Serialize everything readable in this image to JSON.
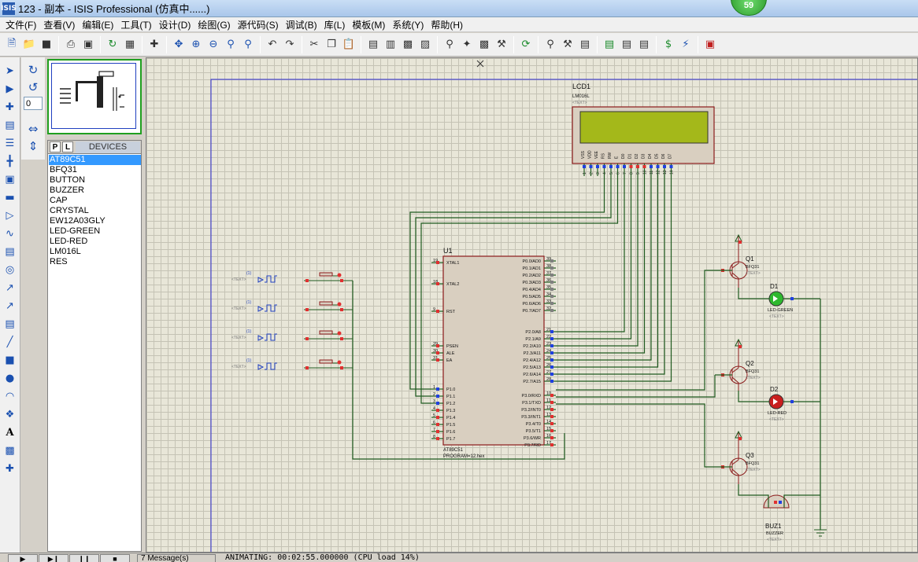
{
  "window": {
    "icon": "ISIS",
    "title": "123 - 副本 - ISIS Professional (仿真中......)",
    "badge": "59"
  },
  "menu": [
    "文件(F)",
    "查看(V)",
    "编辑(E)",
    "工具(T)",
    "设计(D)",
    "绘图(G)",
    "源代码(S)",
    "调试(B)",
    "库(L)",
    "模板(M)",
    "系统(Y)",
    "帮助(H)"
  ],
  "rotation": {
    "angle_value": "0"
  },
  "devices": {
    "tab_p": "P",
    "tab_l": "L",
    "header": "DEVICES",
    "items": [
      "AT89C51",
      "BFQ31",
      "BUTTON",
      "BUZZER",
      "CAP",
      "CRYSTAL",
      "EW12A03GLY",
      "LED-GREEN",
      "LED-RED",
      "LM016L",
      "RES"
    ],
    "selected": "AT89C51"
  },
  "schematic": {
    "lcd": {
      "ref": "LCD1",
      "part": "LM016L",
      "text": "<TEXT>",
      "pins": [
        "VSS",
        "VDD",
        "VEE",
        "RS",
        "RW",
        "E",
        "D0",
        "D1",
        "D2",
        "D3",
        "D4",
        "D5",
        "D6",
        "D7"
      ],
      "pin_numbers": [
        "1",
        "2",
        "3",
        "4",
        "5",
        "6",
        "7",
        "8",
        "9",
        "10",
        "11",
        "12",
        "13",
        "14"
      ]
    },
    "mcu": {
      "ref": "U1",
      "part": "AT89C51",
      "program": "PROGRAM=12.hex",
      "left_pins": [
        {
          "num": "19",
          "name": "XTAL1"
        },
        {
          "num": "18",
          "name": "XTAL2"
        },
        {
          "num": "9",
          "name": "RST"
        },
        {
          "num": "29",
          "name": "PSEN"
        },
        {
          "num": "30",
          "name": "ALE"
        },
        {
          "num": "31",
          "name": "EA"
        },
        {
          "num": "1",
          "name": "P1.0"
        },
        {
          "num": "2",
          "name": "P1.1"
        },
        {
          "num": "3",
          "name": "P1.2"
        },
        {
          "num": "4",
          "name": "P1.3"
        },
        {
          "num": "5",
          "name": "P1.4"
        },
        {
          "num": "6",
          "name": "P1.5"
        },
        {
          "num": "7",
          "name": "P1.6"
        },
        {
          "num": "8",
          "name": "P1.7"
        }
      ],
      "right_pins": [
        {
          "num": "39",
          "name": "P0.0/AD0"
        },
        {
          "num": "38",
          "name": "P0.1/AD1"
        },
        {
          "num": "37",
          "name": "P0.2/AD2"
        },
        {
          "num": "36",
          "name": "P0.3/AD3"
        },
        {
          "num": "35",
          "name": "P0.4/AD4"
        },
        {
          "num": "34",
          "name": "P0.5/AD5"
        },
        {
          "num": "33",
          "name": "P0.6/AD6"
        },
        {
          "num": "32",
          "name": "P0.7/AD7"
        },
        {
          "num": "21",
          "name": "P2.0/A8"
        },
        {
          "num": "22",
          "name": "P2.1/A9"
        },
        {
          "num": "23",
          "name": "P2.2/A10"
        },
        {
          "num": "24",
          "name": "P2.3/A11"
        },
        {
          "num": "25",
          "name": "P2.4/A12"
        },
        {
          "num": "26",
          "name": "P2.5/A13"
        },
        {
          "num": "27",
          "name": "P2.6/A14"
        },
        {
          "num": "28",
          "name": "P2.7/A15"
        },
        {
          "num": "10",
          "name": "P3.0/RXD"
        },
        {
          "num": "11",
          "name": "P3.1/TXD"
        },
        {
          "num": "12",
          "name": "P3.2/INT0"
        },
        {
          "num": "13",
          "name": "P3.3/INT1"
        },
        {
          "num": "14",
          "name": "P3.4/T0"
        },
        {
          "num": "15",
          "name": "P3.5/T1"
        },
        {
          "num": "16",
          "name": "P3.6/WR"
        },
        {
          "num": "17",
          "name": "P3.7/RD"
        }
      ]
    },
    "transistors": [
      {
        "ref": "Q1",
        "part": "BFQ31",
        "text": "<TEXT>"
      },
      {
        "ref": "Q2",
        "part": "BFQ31",
        "text": "<TEXT>"
      },
      {
        "ref": "Q3",
        "part": "BFQ31",
        "text": "<TEXT>"
      }
    ],
    "leds": [
      {
        "ref": "D1",
        "part": "LED-GREEN",
        "text": "<TEXT>",
        "color": "#2eb82e"
      },
      {
        "ref": "D2",
        "part": "LED-RED",
        "text": "<TEXT>",
        "color": "#c81e1e"
      }
    ],
    "buzzer": {
      "ref": "BUZ1",
      "part": "BUZZER",
      "text": "<TEXT>"
    },
    "generators": [
      {
        "label": "(1)",
        "text": "<TEXT>"
      },
      {
        "label": "(1)",
        "text": "<TEXT>"
      },
      {
        "label": "(1)",
        "text": "<TEXT>"
      },
      {
        "label": "(1)",
        "text": "<TEXT>"
      }
    ],
    "colors": {
      "wire": "#1f5a1f",
      "part_outline": "#8b1a1a",
      "part_fill": "#d9cfc0",
      "lcd_screen": "#a4b81a",
      "pin_red": "#e03030",
      "pin_blue": "#2040e0"
    }
  },
  "status": {
    "messages": "7 Message(s)",
    "animating": "ANIMATING: 00:02:55.000000 (CPU load 14%)"
  }
}
